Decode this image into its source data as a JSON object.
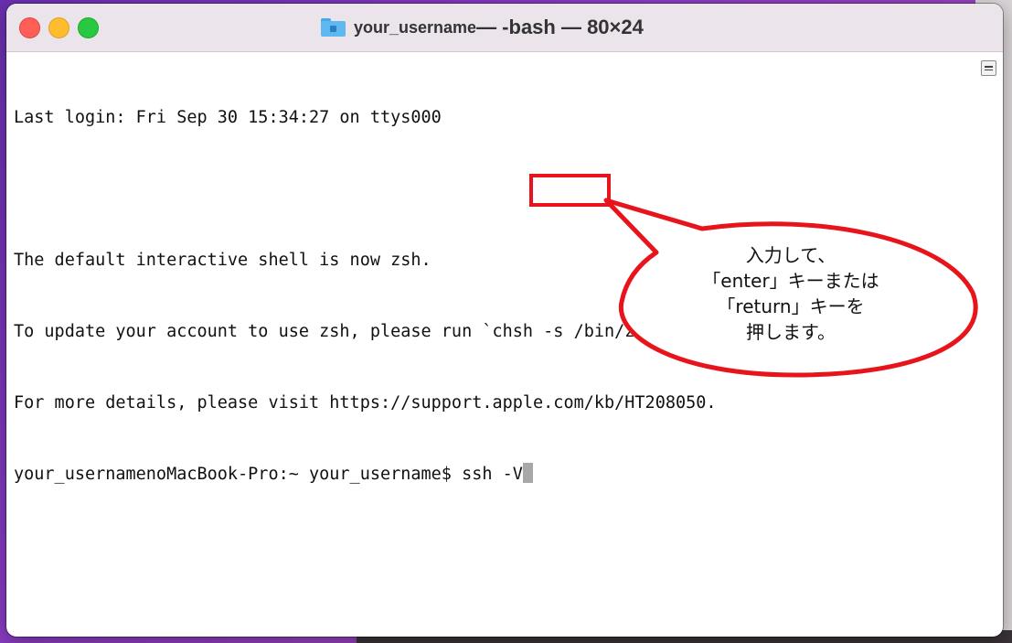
{
  "window": {
    "title_user": "your_username",
    "title_rest": " — -bash — 80×24"
  },
  "terminal": {
    "lines": [
      "Last login: Fri Sep 30 15:34:27 on ttys000",
      "",
      "The default interactive shell is now zsh.",
      "To update your account to use zsh, please run `chsh -s /bin/zsh`.",
      "For more details, please visit https://support.apple.com/kb/HT208050."
    ],
    "prompt": "your_usernamenoMacBook-Pro:~ your_username$ ",
    "command": "ssh -V"
  },
  "annotation": {
    "lines": [
      "入力して、",
      "「enter」キーまたは",
      "「return」キーを",
      "押します。"
    ],
    "color": "#e8141b"
  },
  "icons": {
    "folder": "home-folder-icon",
    "scroll": "scroll-menu-icon"
  },
  "colors": {
    "close": "#ff5f57",
    "minimize": "#febc2e",
    "maximize": "#28c840",
    "titlebar": "#ebe4ea"
  }
}
